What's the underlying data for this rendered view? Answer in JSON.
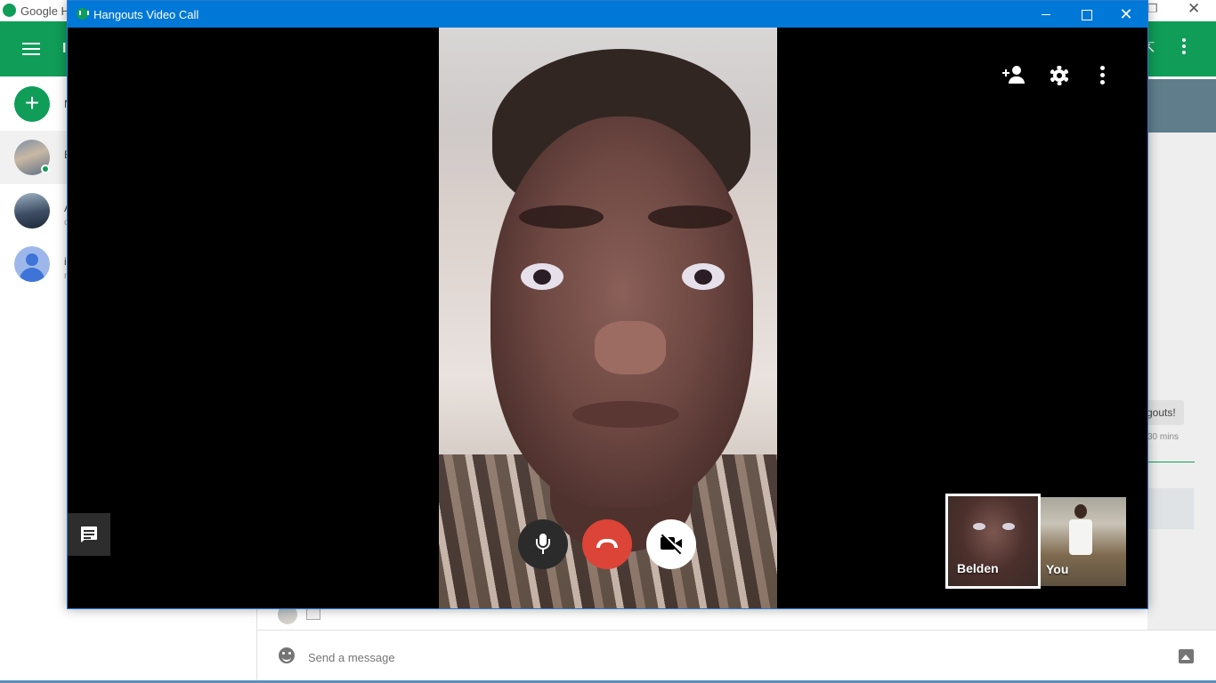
{
  "background_app": {
    "title": "Google Hangouts",
    "title_visible": "Google H",
    "header_letter": "I",
    "new_conversation_label": "N",
    "contacts": [
      {
        "initial": "B",
        "sub": "",
        "online": true,
        "selected": true
      },
      {
        "initial": "A",
        "sub": "o",
        "online": false,
        "selected": false
      },
      {
        "initial": "i",
        "sub": "n",
        "online": false,
        "selected": false
      }
    ],
    "chat": {
      "message_fragment": "gouts!",
      "time_fragment": "30 mins"
    },
    "compose": {
      "placeholder": "Send a message"
    }
  },
  "call_window": {
    "title": "Hangouts Video Call",
    "controls": {
      "minimize": "minimize",
      "maximize": "maximize",
      "close": "✕"
    },
    "top_icons": [
      "add-person-icon",
      "settings-icon",
      "more-vert-icon"
    ],
    "bottom_buttons": [
      "mic-icon",
      "hangup-icon",
      "video-off-icon"
    ],
    "participants": [
      {
        "name": "Belden",
        "active": true
      },
      {
        "name": "You",
        "active": false
      }
    ]
  },
  "colors": {
    "hangouts_green": "#0f9d58",
    "titlebar_blue": "#0078d7",
    "hangup_red": "#db4437",
    "chat_header": "#607d8b"
  }
}
